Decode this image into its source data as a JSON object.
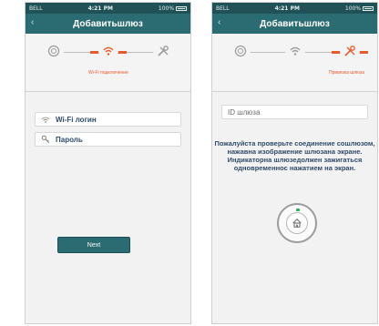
{
  "colors": {
    "navbar": "#2b6c72",
    "statusbar": "#1f5157",
    "accent_orange": "#e85b2c",
    "text_blue": "#2e4b6a",
    "led_green": "#2eb15a"
  },
  "left": {
    "status": {
      "carrier": "BELL",
      "time": "4:21 PM",
      "battery": "100%"
    },
    "title": "Добавитьшлюз",
    "back": "‹",
    "steps": {
      "icons": [
        "gateway-icon",
        "wifi-icon",
        "tools-icon"
      ],
      "active_index": 1,
      "active_label": "Wi-Fi подключение"
    },
    "fields": {
      "wifi_login": "Wi-Fi логин",
      "password": "Пароль"
    },
    "next_label": "Next"
  },
  "right": {
    "status": {
      "carrier": "BELL",
      "time": "4:21 PM",
      "battery": "100%"
    },
    "title": "Добавитьшлюз",
    "back": "‹",
    "steps": {
      "icons": [
        "gateway-icon",
        "wifi-icon",
        "tools-icon"
      ],
      "active_index": 2,
      "active_label": "Привязка шлюза"
    },
    "gateway_id_placeholder": "ID шлюза",
    "instruction": "Пожалуйста проверьте соединение сошлюзом, нажавна изображение шлюзана экране. Индикаторна шлюзедолжен зажигаться одновременнос нажатием на экран."
  }
}
